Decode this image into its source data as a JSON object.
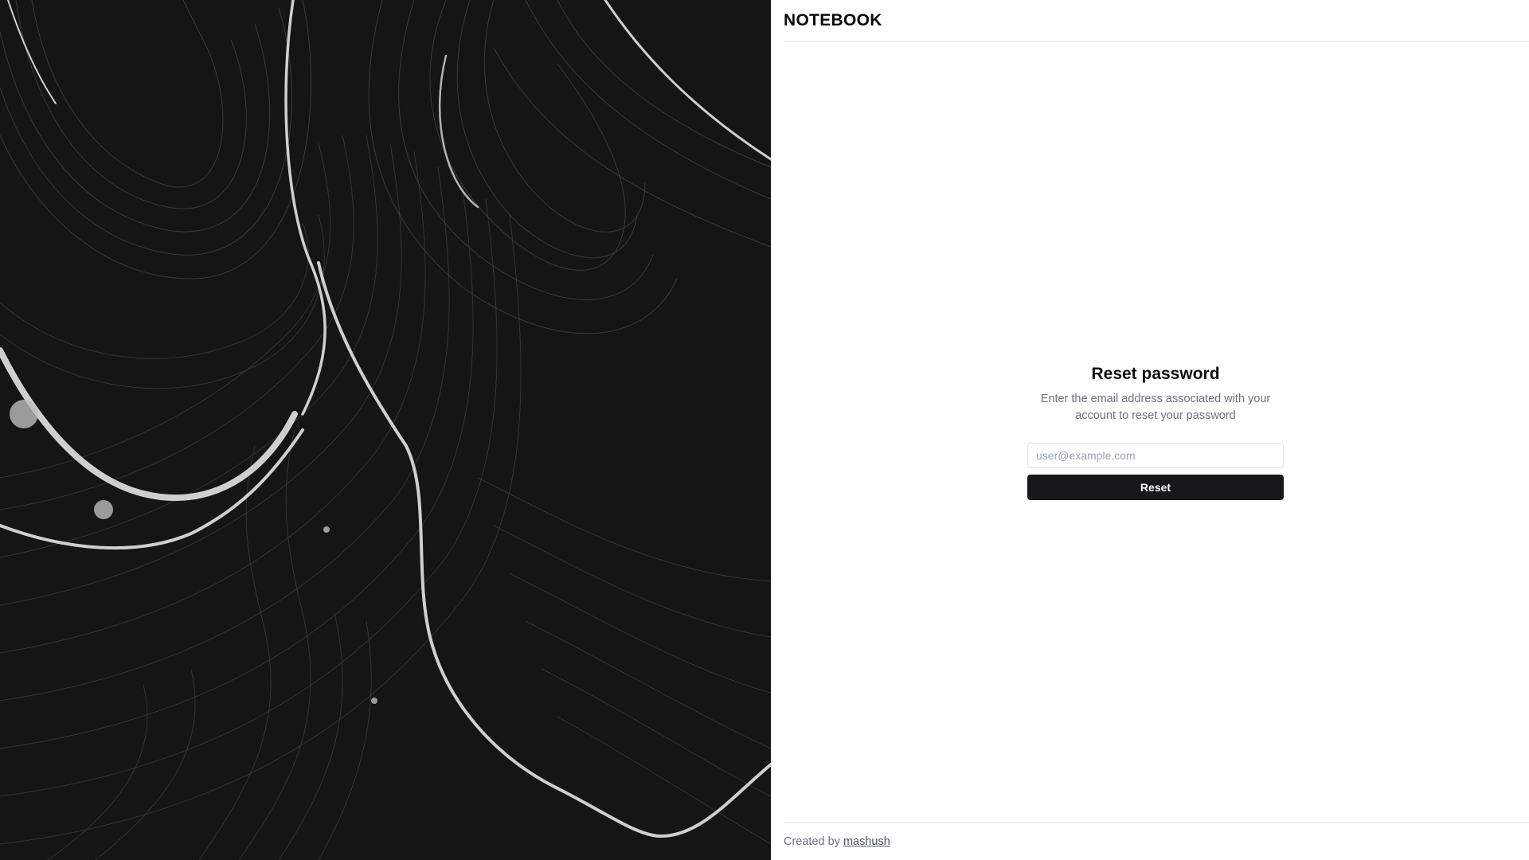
{
  "header": {
    "logo": "NOTEBOOK"
  },
  "form": {
    "title": "Reset password",
    "description": "Enter the email address associated with your account to reset your password",
    "email_placeholder": "user@example.com",
    "email_value": "",
    "submit_label": "Reset"
  },
  "footer": {
    "credit_prefix": "Created by",
    "author_link": "mashush"
  },
  "colors": {
    "hero_background": "#161616",
    "button_background": "#18181b",
    "button_text": "#ffffff",
    "muted_text": "#6b7280",
    "divider": "#e5e7eb"
  }
}
